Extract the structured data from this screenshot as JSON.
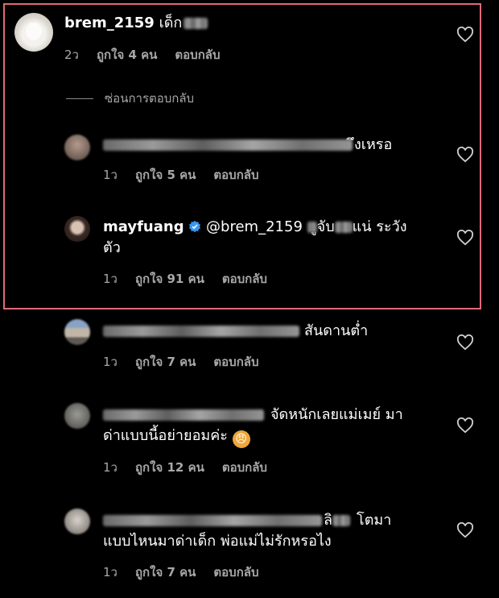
{
  "comments": [
    {
      "username": "brem_2159",
      "text": "เด็ก",
      "time": "2ว",
      "likes": "ถูกใจ 4 คน",
      "reply": "ตอบกลับ"
    },
    {
      "text": "ึงเหรอ",
      "time": "1ว",
      "likes": "ถูกใจ 5 คน",
      "reply": "ตอบกลับ"
    },
    {
      "username": "mayfuang",
      "mention": "@brem_2159",
      "text_a": "ูจับ",
      "text_b": "แน่ ระวัง",
      "text_line2": "ตัว",
      "time": "1ว",
      "likes": "ถูกใจ 91 คน",
      "reply": "ตอบกลับ"
    },
    {
      "text": "สันดานต่ำ",
      "time": "1ว",
      "likes": "ถูกใจ 7 คน",
      "reply": "ตอบกลับ"
    },
    {
      "text_line1": "จัดหนักเลยแม่เมย์ มา",
      "text_line2": "ด่าแบบนี้อย่ายอมค่ะ",
      "emoji": "😠",
      "time": "1ว",
      "likes": "ถูกใจ 12 คน",
      "reply": "ตอบกลับ"
    },
    {
      "text_a": "ลิ",
      "text_b": "โตมา",
      "text_line2": "แบบไหนมาด่าเด็ก พ่อแม่ไม่รักหรอไง",
      "time": "1ว",
      "likes": "ถูกใจ 7 คน",
      "reply": "ตอบกลับ"
    }
  ],
  "hide_replies_label": "ซ่อนการตอบกลับ",
  "colors": {
    "highlight_border": "#e06a78",
    "verified": "#3897f0",
    "meta": "#a8a8a8"
  }
}
